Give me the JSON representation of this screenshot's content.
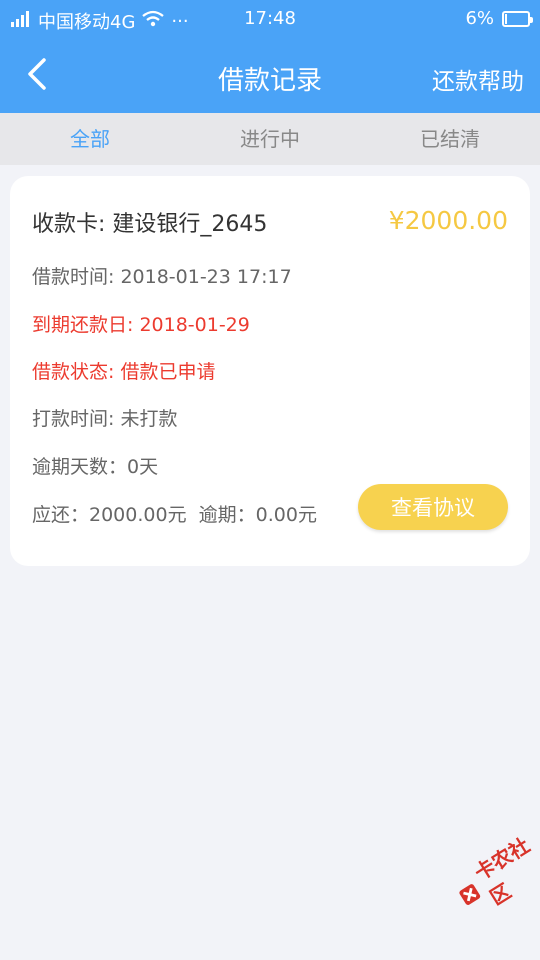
{
  "status_bar": {
    "carrier": "中国移动4G",
    "dots": "···",
    "time": "17:48",
    "battery": "6%"
  },
  "header": {
    "title": "借款记录",
    "help_label": "还款帮助"
  },
  "tabs": [
    {
      "label": "全部",
      "active": true
    },
    {
      "label": "进行中",
      "active": false
    },
    {
      "label": "已结清",
      "active": false
    }
  ],
  "record": {
    "card_label": "收款卡: 建设银行_2645",
    "amount": "¥2000.00",
    "loan_time": "借款时间: 2018-01-23 17:17",
    "due_date": "到期还款日: 2018-01-29",
    "loan_status": "借款状态: 借款已申请",
    "payment_time": "打款时间: 未打款",
    "overdue_days": "逾期天数：0天",
    "summary": "应还：2000.00元  逾期：0.00元",
    "view_button": "查看协议"
  },
  "watermark": {
    "text": "卡农社区"
  },
  "colors": {
    "accent": "#4aa3f7",
    "amount": "#f5c842",
    "warning": "#ec3b2f",
    "button": "#f7d24f"
  }
}
